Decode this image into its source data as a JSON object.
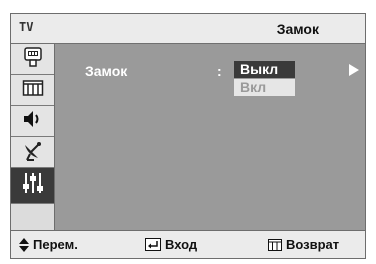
{
  "header": {
    "tv_label": "TV",
    "title": "Замок"
  },
  "sidebar": {
    "items": [
      {
        "icon": "picture-icon"
      },
      {
        "icon": "channel-list-icon"
      },
      {
        "icon": "speaker-icon"
      },
      {
        "icon": "satellite-dish-icon"
      },
      {
        "icon": "setup-sliders-icon",
        "active": true
      }
    ]
  },
  "main": {
    "lock_label": "Замок",
    "separator": ":",
    "options": [
      "Выкл",
      "Вкл"
    ],
    "selected": "Выкл"
  },
  "footer": {
    "move_label": "Перем.",
    "enter_label": "Вход",
    "back_label": "Возврат"
  }
}
